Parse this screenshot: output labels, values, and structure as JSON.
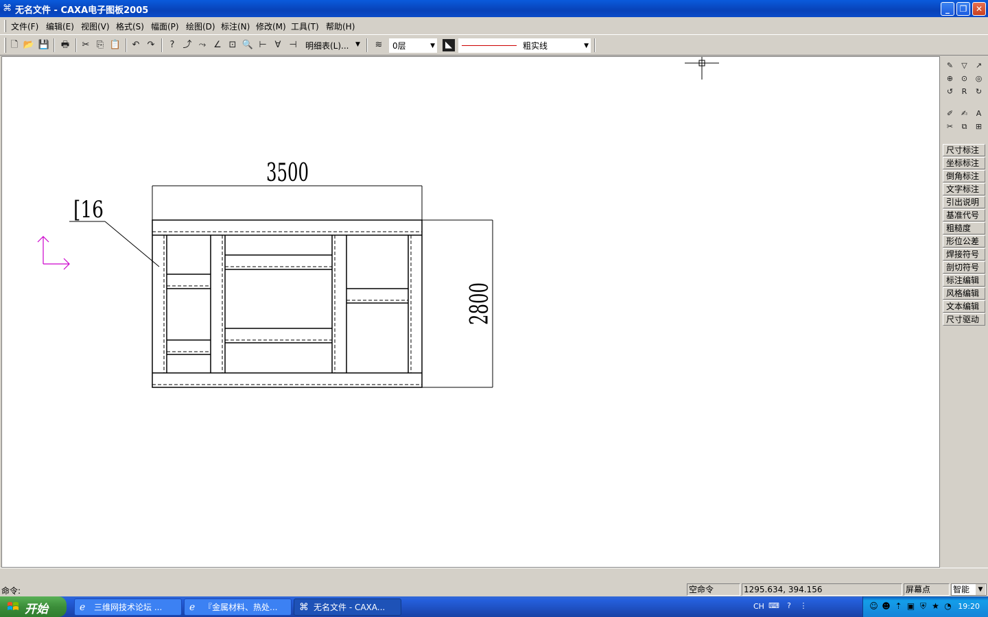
{
  "window": {
    "title": "无名文件 - CAXA电子图板2005",
    "min": "_",
    "max": "❐",
    "close": "✕"
  },
  "menu": [
    "文件(F)",
    "编辑(E)",
    "视图(V)",
    "格式(S)",
    "幅面(P)",
    "绘图(D)",
    "标注(N)",
    "修改(M)",
    "工具(T)",
    "帮助(H)"
  ],
  "toolbar": {
    "detail_table_label": "明细表(L)...",
    "layer_value": "0层",
    "linetype_value": "粗实线",
    "line_color": "#cc0000"
  },
  "drawing": {
    "dimension_width": "3500",
    "dimension_height": "2800",
    "leader_label": "[16",
    "ucs_color": "#cc00cc"
  },
  "right_panel": {
    "buttons": [
      "尺寸标注",
      "坐标标注",
      "倒角标注",
      "文字标注",
      "引出说明",
      "基准代号",
      "粗糙度",
      "形位公差",
      "焊接符号",
      "剖切符号",
      "标注编辑",
      "风格编辑",
      "文本编辑",
      "尺寸驱动"
    ]
  },
  "status": {
    "command_label": "命令:",
    "command_state": "空命令",
    "coordinates": "1295.634, 394.156",
    "snap_mode": "屏幕点",
    "snap_select": "智能"
  },
  "taskbar": {
    "start_label": "开始",
    "tasks": [
      {
        "label": "三维网技术论坛 ..."
      },
      {
        "label": "『金属材料、热处..."
      },
      {
        "label": "无名文件 - CAXA..."
      }
    ],
    "lang": "CH",
    "clock": "19:20"
  }
}
